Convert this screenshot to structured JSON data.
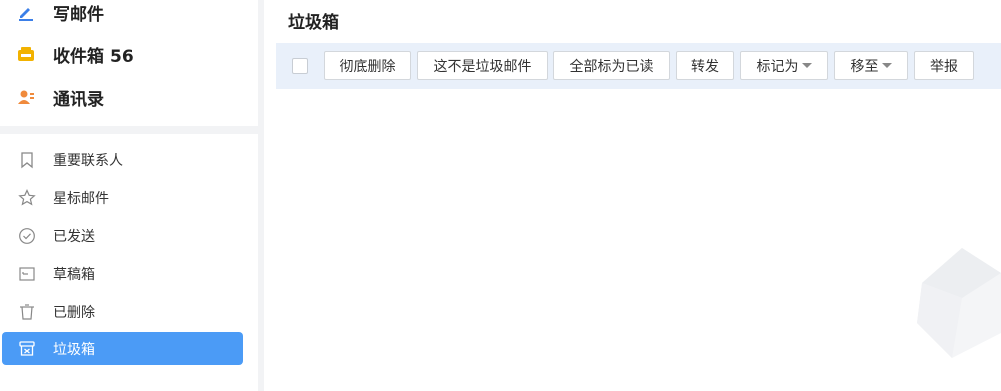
{
  "sidebar": {
    "compose_label": "写邮件",
    "inbox_label": "收件箱",
    "inbox_count": "56",
    "contacts_label": "通讯录",
    "folders": [
      {
        "label": "重要联系人",
        "icon": "bookmark-icon"
      },
      {
        "label": "星标邮件",
        "icon": "star-icon"
      },
      {
        "label": "已发送",
        "icon": "check-circle-icon"
      },
      {
        "label": "草稿箱",
        "icon": "draft-icon"
      },
      {
        "label": "已删除",
        "icon": "trash-icon"
      },
      {
        "label": "垃圾箱",
        "icon": "spam-bin-icon",
        "active": true
      }
    ]
  },
  "main": {
    "title": "垃圾箱",
    "toolbar": {
      "delete_permanently": "彻底删除",
      "not_spam": "这不是垃圾邮件",
      "mark_all_read": "全部标为已读",
      "forward": "转发",
      "mark_as": "标记为",
      "move_to": "移至",
      "report": "举报"
    }
  },
  "colors": {
    "accent": "#4b9bf6",
    "toolbar_bg": "#e9f0fa",
    "compose_icon": "#3b7fe8",
    "inbox_icon": "#f2b200",
    "contacts_icon": "#f08a3c"
  }
}
